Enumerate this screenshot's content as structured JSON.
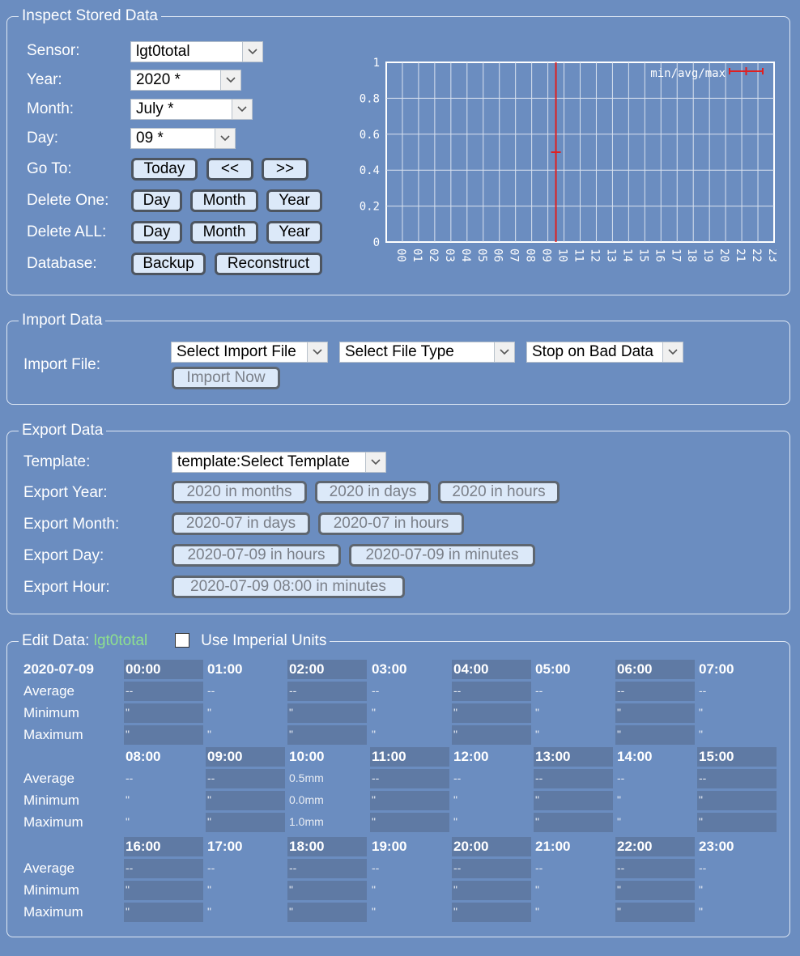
{
  "inspect": {
    "title": "Inspect Stored Data",
    "sensor_label": "Sensor:",
    "sensor_value": "lgt0total",
    "year_label": "Year:",
    "year_value": "2020 *",
    "month_label": "Month:",
    "month_value": "July *",
    "day_label": "Day:",
    "day_value": "09 *",
    "goto_label": "Go To:",
    "goto_buttons": [
      "Today",
      "<<",
      ">>"
    ],
    "delete_one_label": "Delete One:",
    "delete_all_label": "Delete ALL:",
    "delete_buttons": [
      "Day",
      "Month",
      "Year"
    ],
    "database_label": "Database:",
    "backup_label": "Backup",
    "reconstruct_label": "Reconstruct"
  },
  "chart_data": {
    "type": "errorbar",
    "legend": "min/avg/max",
    "legend_position": "top-right",
    "x_tick_labels": [
      "00",
      "01",
      "02",
      "03",
      "04",
      "05",
      "06",
      "07",
      "08",
      "09",
      "10",
      "11",
      "12",
      "13",
      "14",
      "15",
      "16",
      "17",
      "18",
      "19",
      "20",
      "21",
      "22",
      "23"
    ],
    "y_tick_labels": [
      "0",
      "0.2",
      "0.4",
      "0.6",
      "0.8",
      "1"
    ],
    "ylim": [
      0,
      1
    ],
    "grid": true,
    "series_color": "#e02020",
    "points": [
      {
        "x": "10",
        "min": 0.0,
        "avg": 0.5,
        "max": 1.0
      }
    ]
  },
  "import": {
    "title": "Import Data",
    "file_label": "Import File:",
    "select_file": "Select Import File",
    "select_type": "Select File Type",
    "stop_option": "Stop on Bad Data",
    "import_now": "Import Now"
  },
  "export": {
    "title": "Export Data",
    "template_label": "Template:",
    "template_value": "template:Select Template",
    "year_label": "Export Year:",
    "year_buttons": [
      "2020 in months",
      "2020 in days",
      "2020 in hours"
    ],
    "month_label": "Export Month:",
    "month_buttons": [
      "2020-07 in days",
      "2020-07 in hours"
    ],
    "day_label": "Export Day:",
    "day_buttons": [
      "2020-07-09 in hours",
      "2020-07-09 in minutes"
    ],
    "hour_label": "Export Hour:",
    "hour_buttons": [
      "2020-07-09 08:00 in minutes"
    ]
  },
  "edit": {
    "title": "Edit Data:",
    "sensor": "lgt0total",
    "sensor_color": "#8ee08e",
    "imperial_label": "Use Imperial Units",
    "date": "2020-07-09",
    "row_labels": [
      "Average",
      "Minimum",
      "Maximum"
    ],
    "hours": [
      "00:00",
      "01:00",
      "02:00",
      "03:00",
      "04:00",
      "05:00",
      "06:00",
      "07:00",
      "08:00",
      "09:00",
      "10:00",
      "11:00",
      "12:00",
      "13:00",
      "14:00",
      "15:00",
      "16:00",
      "17:00",
      "18:00",
      "19:00",
      "20:00",
      "21:00",
      "22:00",
      "23:00"
    ],
    "empty_avg": "--",
    "empty_minmax": "\"",
    "hour10": {
      "avg": "0.5mm",
      "min": "0.0mm",
      "max": "1.0mm"
    }
  }
}
